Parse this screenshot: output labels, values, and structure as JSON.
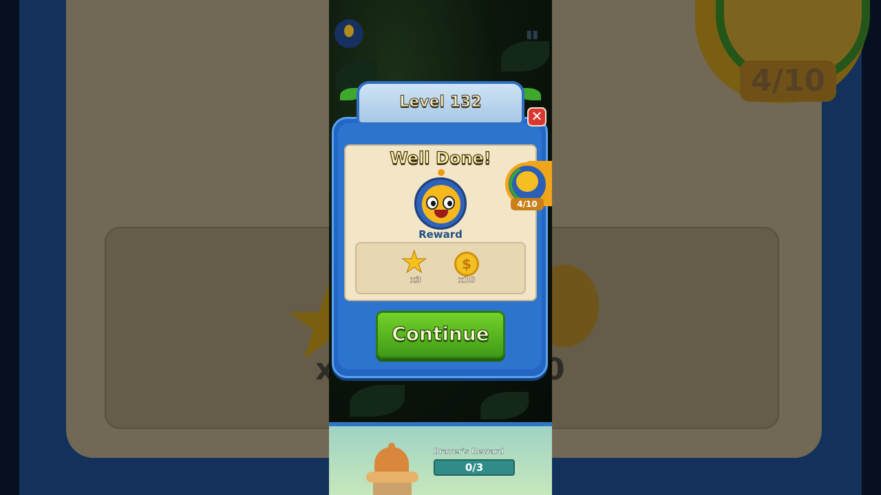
{
  "dialog": {
    "title": "Level 132",
    "heading": "Well Done!",
    "reward_label": "Reward",
    "rewards": [
      {
        "icon": "star-icon",
        "quantity": "x3"
      },
      {
        "icon": "coin-icon",
        "quantity": "x10"
      }
    ],
    "continue_label": "Continue"
  },
  "bee_progress": {
    "text": "4/10",
    "current": 4,
    "total": 10
  },
  "bottom": {
    "label": "Braver's Reward",
    "progress_text": "0/3",
    "current": 0,
    "total": 3
  },
  "background": {
    "multiplier_left": "x",
    "multiplier_right": "0"
  },
  "colors": {
    "dialog_blue": "#2466c4",
    "card_cream": "#f3e6c7",
    "continue_green": "#4fb01b",
    "close_red": "#d9372f",
    "gold": "#f5c21a"
  }
}
